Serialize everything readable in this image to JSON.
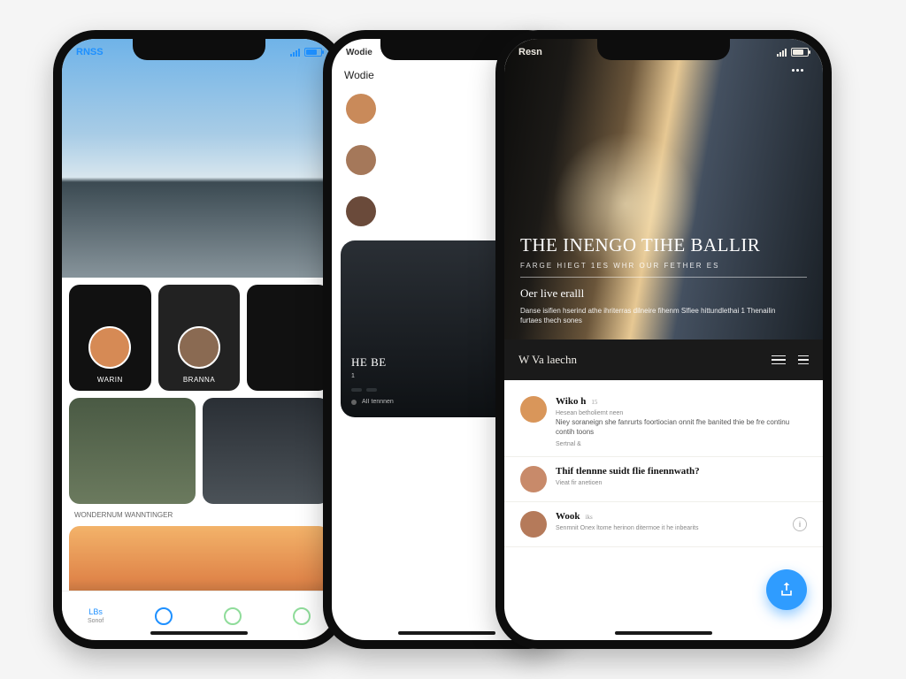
{
  "phone1": {
    "status_left": "RNSS",
    "stories": [
      {
        "label": "WARIN",
        "sub": ""
      },
      {
        "label": "BRANNA",
        "sub": ""
      },
      {
        "label": "",
        "sub": ""
      }
    ],
    "caption": "WONDERNUM WANNTINGER",
    "tabbar": {
      "left": "LBs",
      "left_sub": "Sonof",
      "right": ""
    }
  },
  "phone2": {
    "title": "Wodie",
    "stories": [
      {
        "name": "",
        "sub": ""
      },
      {
        "name": "",
        "sub": ""
      },
      {
        "name": "",
        "sub": ""
      }
    ],
    "card": {
      "title": "HE BE",
      "sub": "1",
      "chips": [
        "",
        ""
      ],
      "meta": "AII tennnen"
    }
  },
  "phone3": {
    "status_left": "Resn",
    "header_label": "",
    "hero": {
      "title": "The Inengo Tihe Ballir",
      "subline": "FARGE HIEGT 1ES   WHR   OUR FETHER ES",
      "section": "Oer live eralll",
      "body": "Danse isifien hserind athe ihriterras dilneire fihenm Slfiee hittundlethai 1 Thenailin furtaes thech sones"
    },
    "nav_label": "W Va laechn",
    "posts": [
      {
        "name": "Wiko h",
        "time": "15",
        "sub": "Hesean betholiernt neen",
        "body": "Niey soraneign she fanrurts foortiocian onnit fhe banited thie be fre continu contih toons",
        "link": "Sertnal &"
      },
      {
        "name": "Thif tlennne suidt flie finennwath?",
        "time": "",
        "sub": "Vieat fir anetioen",
        "body": "",
        "link": ""
      },
      {
        "name": "Wook",
        "time": "iks",
        "sub": "Senmnit  Onex ltome herinon ditermoe it he inbearits",
        "body": "",
        "link": ""
      }
    ]
  }
}
